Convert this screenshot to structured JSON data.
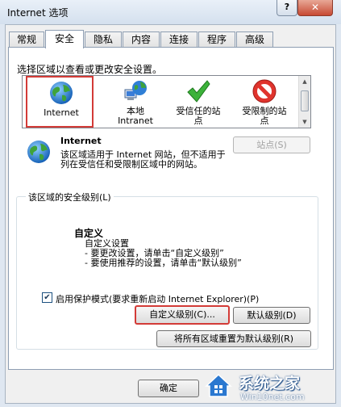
{
  "window": {
    "title": "Internet 选项",
    "help_label": "?",
    "close_label": "✕"
  },
  "tabs": [
    {
      "label": "常规"
    },
    {
      "label": "安全"
    },
    {
      "label": "隐私"
    },
    {
      "label": "内容"
    },
    {
      "label": "连接"
    },
    {
      "label": "程序"
    },
    {
      "label": "高级"
    }
  ],
  "active_tab": "安全",
  "zones": {
    "prompt": "选择区域以查看或更改安全设置。",
    "items": [
      {
        "label": "Internet",
        "icon": "globe-icon",
        "selected": true
      },
      {
        "label": "本地\nIntranet",
        "icon": "intranet-globe-icon"
      },
      {
        "label": "受信任的站\n点",
        "icon": "green-check-icon"
      },
      {
        "label": "受限制的站\n点",
        "icon": "no-entry-icon"
      }
    ]
  },
  "selected_zone": {
    "name": "Internet",
    "description": "该区域适用于 Internet 网站，但不适用于列在受信任和受限制区域中的网站。"
  },
  "sites_button": "站点(S)",
  "security_level": {
    "group_label": "该区域的安全级别(L)",
    "title": "自定义",
    "lines": [
      "自定义设置",
      "- 要更改设置，请单击“自定义级别”",
      "- 要使用推荐的设置，请单击“默认级别”"
    ]
  },
  "protected_mode": {
    "label": "启用保护模式(要求重新启动 Internet Explorer)(P)",
    "checked": true
  },
  "buttons": {
    "custom_level": "自定义级别(C)...",
    "default_level": "默认级别(D)",
    "reset_all": "将所有区域重置为默认级别(R)",
    "ok": "确定"
  },
  "watermark": {
    "text": "系统之家",
    "url": "Win10net.com"
  },
  "colors": {
    "highlight_border": "#d33b37",
    "title_bar": "#d4e0ee"
  }
}
